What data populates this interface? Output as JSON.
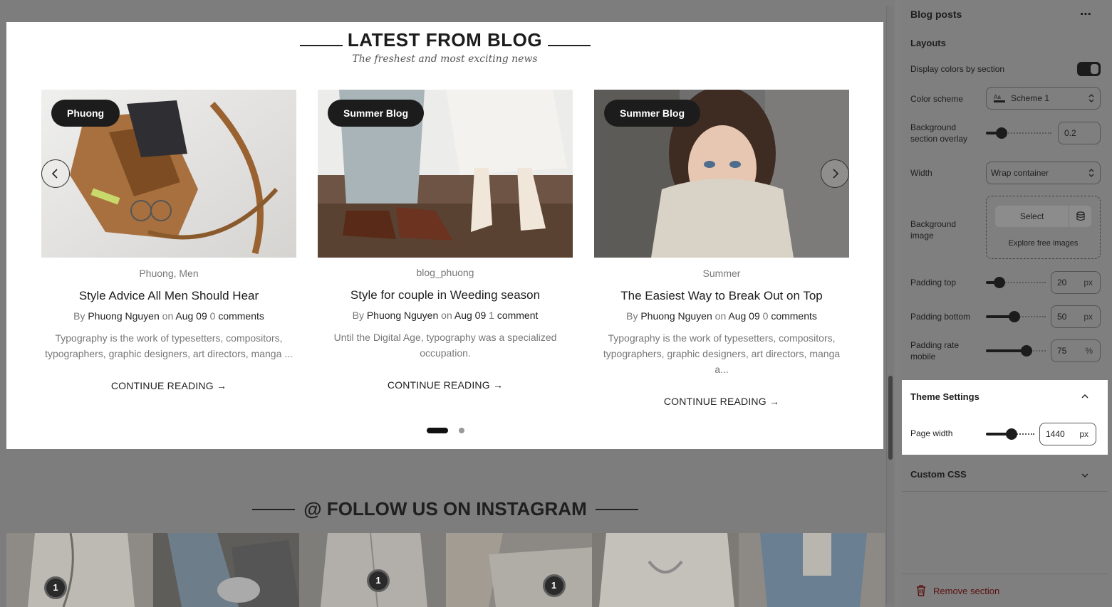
{
  "preview": {
    "blog": {
      "heading": "LATEST FROM BLOG",
      "subheading": "The freshest and most exciting news",
      "posts": [
        {
          "badge": "Phuong",
          "category": "Phuong, Men",
          "title": "Style Advice All Men Should Hear",
          "by": "By",
          "author": "Phuong Nguyen",
          "on": "on",
          "date": "Aug 09",
          "comments_count": "0",
          "comments_word": "comments",
          "excerpt": "Typography is the work of typesetters, compositors, typographers, graphic designers, art directors, manga ...",
          "cta": "CONTINUE READING"
        },
        {
          "badge": "Summer Blog",
          "category": "blog_phuong",
          "title": "Style for couple in Weeding season",
          "by": "By",
          "author": "Phuong Nguyen",
          "on": "on",
          "date": "Aug 09",
          "comments_count": "1",
          "comments_word": "comment",
          "excerpt": "Until the Digital Age, typography was a specialized occupation.",
          "cta": "CONTINUE READING"
        },
        {
          "badge": "Summer Blog",
          "category": "Summer",
          "title": "The Easiest Way to Break Out on Top",
          "by": "By",
          "author": "Phuong Nguyen",
          "on": "on",
          "date": "Aug 09",
          "comments_count": "0",
          "comments_word": "comments",
          "excerpt": "Typography is the work of typesetters, compositors, typographers, graphic designers, art directors, manga a...",
          "cta": "CONTINUE READING"
        }
      ],
      "pagination": {
        "pages": 2,
        "active": 1
      }
    },
    "instagram": {
      "heading": "@ FOLLOW US ON INSTAGRAM",
      "badges": [
        "1",
        "1",
        "1"
      ]
    }
  },
  "panel": {
    "title": "Blog posts",
    "more_icon": "more-horizontal-icon",
    "layouts_label": "Layouts",
    "display_colors_label": "Display colors by section",
    "display_colors_on": true,
    "color_scheme_label": "Color scheme",
    "color_scheme_value": "Scheme 1",
    "bg_overlay_label": "Background section overlay",
    "bg_overlay_value": "0.2",
    "width_label": "Width",
    "width_value": "Wrap container",
    "bg_image_label": "Background image",
    "bg_image_select": "Select",
    "bg_image_explore": "Explore free images",
    "padding_top_label": "Padding top",
    "padding_top_value": "20",
    "padding_bottom_label": "Padding bottom",
    "padding_bottom_value": "50",
    "padding_mobile_label": "Padding rate mobile",
    "padding_mobile_value": "75",
    "unit_px": "px",
    "unit_pct": "%",
    "theme_settings_label": "Theme Settings",
    "page_width_label": "Page width",
    "page_width_value": "1440",
    "custom_css_label": "Custom CSS",
    "remove_label": "Remove section",
    "colors": {
      "danger": "#5a1010",
      "knob": "#1c1c1c"
    }
  }
}
